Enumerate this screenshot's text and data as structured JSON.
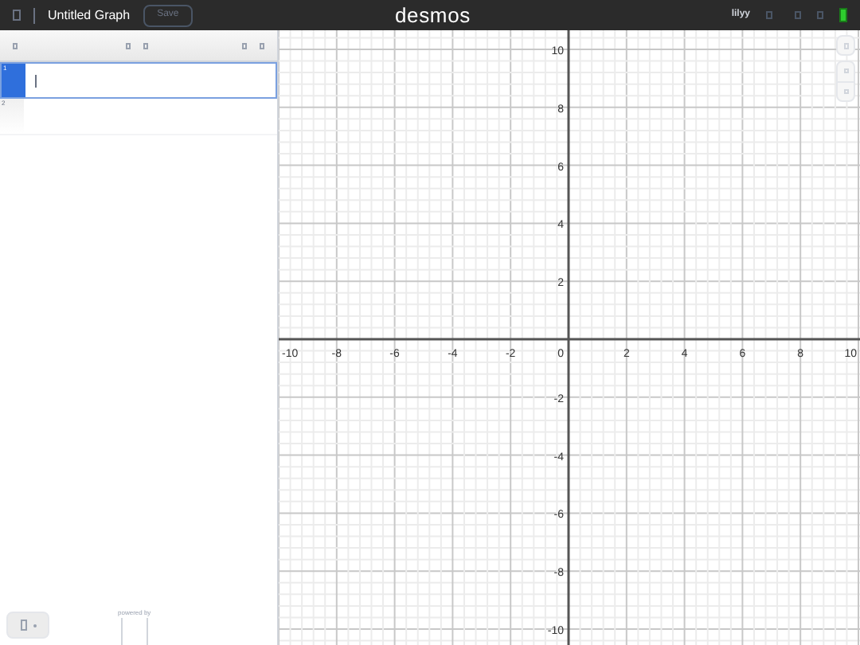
{
  "header": {
    "title": "Untitled Graph",
    "save": "Save",
    "logo": "desmos",
    "user": "lilyy"
  },
  "expressions": [
    {
      "index": "1",
      "selected": true
    },
    {
      "index": "2",
      "selected": false
    }
  ],
  "graph": {
    "x_ticks": [
      "-10",
      "-8",
      "-6",
      "-4",
      "-2",
      "2",
      "4",
      "6",
      "8",
      "10"
    ],
    "y_ticks": [
      "10",
      "8",
      "6",
      "4",
      "2",
      "-2",
      "-4",
      "-6",
      "-8",
      "-10"
    ],
    "origin": "0"
  },
  "footer": {
    "powered_by": "powered by"
  }
}
